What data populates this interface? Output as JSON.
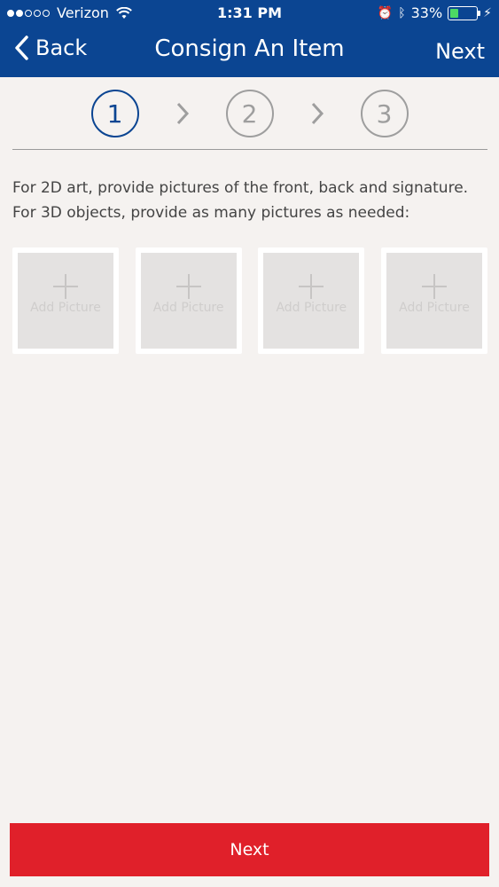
{
  "status_bar": {
    "carrier": "Verizon",
    "time": "1:31 PM",
    "battery": "33%",
    "battery_level": 0.33,
    "signal_bars": 2,
    "icons": [
      "wifi-icon",
      "alarm-icon",
      "bluetooth-icon",
      "battery-icon",
      "charging-icon"
    ]
  },
  "nav": {
    "back_label": "Back",
    "title": "Consign An Item",
    "next_label": "Next"
  },
  "steps": [
    {
      "label": "1",
      "active": true
    },
    {
      "label": "2",
      "active": false
    },
    {
      "label": "3",
      "active": false
    }
  ],
  "instructions": {
    "line1": "For 2D art, provide pictures of the front, back and signature.",
    "line2": "For 3D objects, provide as many pictures as needed:"
  },
  "picture_slots": [
    {
      "label": "Add Picture"
    },
    {
      "label": "Add Picture"
    },
    {
      "label": "Add Picture"
    },
    {
      "label": "Add Picture"
    }
  ],
  "footer": {
    "next_label": "Next"
  },
  "colors": {
    "nav_background": "#0b4592",
    "active_step": "#0b4592",
    "inactive_step": "#9e9e9e",
    "primary_button": "#e0202a",
    "page_background": "#f5f2f0"
  }
}
